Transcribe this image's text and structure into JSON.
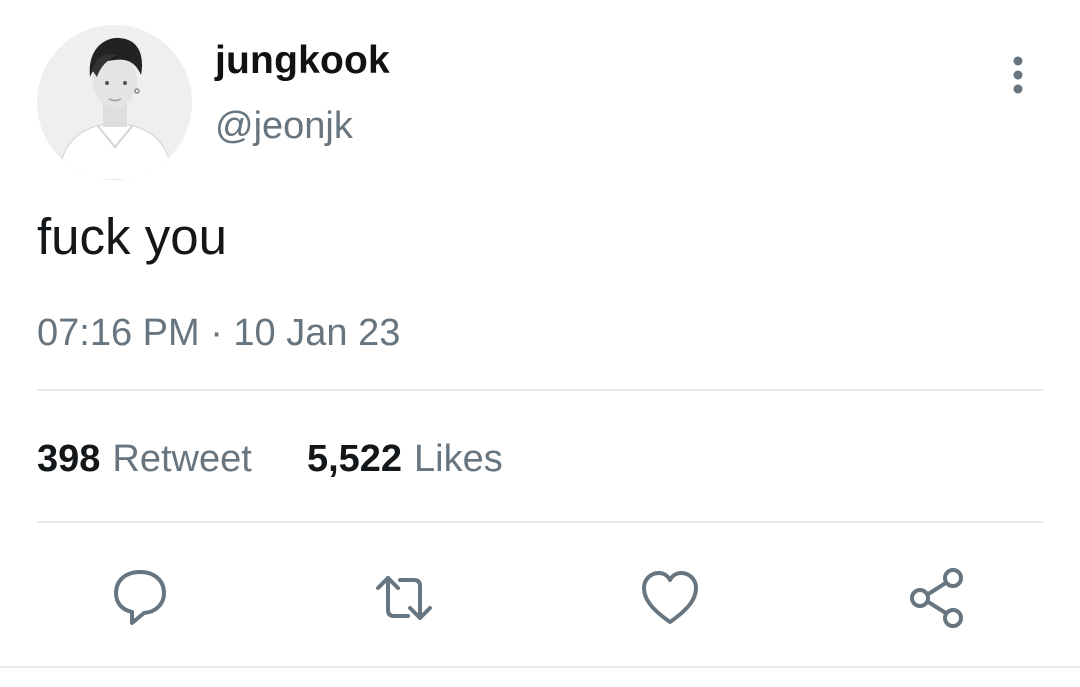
{
  "tweet": {
    "author": {
      "display_name": "jungkook",
      "handle": "@jeonjk",
      "avatar_icon": "profile-photo"
    },
    "text": "fuck you",
    "timestamp": "07:16 PM · 10 Jan 23",
    "stats": {
      "retweets_count": "398",
      "retweets_label": "Retweet",
      "likes_count": "5,522",
      "likes_label": "Likes"
    }
  },
  "actions": {
    "more_icon": "more-vertical-icon",
    "reply_icon": "reply-icon",
    "retweet_icon": "retweet-icon",
    "like_icon": "heart-icon",
    "share_icon": "share-icon"
  },
  "colors": {
    "primary_text": "#14171a",
    "secondary_text": "#66757f",
    "icon": "#66757f",
    "divider": "#e6ecf0",
    "background": "#ffffff"
  }
}
